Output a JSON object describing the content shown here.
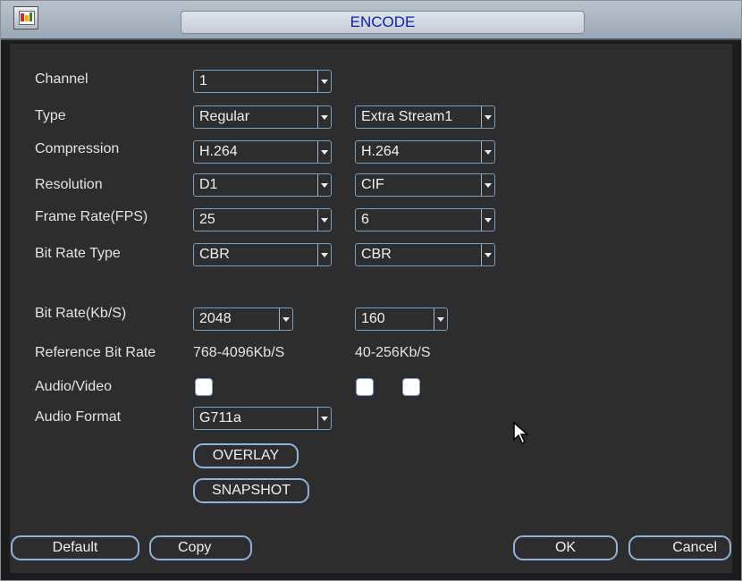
{
  "window": {
    "title": "ENCODE"
  },
  "labels": {
    "channel": "Channel",
    "type": "Type",
    "compression": "Compression",
    "resolution": "Resolution",
    "frame_rate": "Frame Rate(FPS)",
    "bit_rate_type": "Bit Rate Type",
    "bit_rate": "Bit Rate(Kb/S)",
    "reference_bit_rate": "Reference Bit Rate",
    "audio_video": "Audio/Video",
    "audio_format": "Audio Format"
  },
  "main_stream": {
    "channel": "1",
    "type": "Regular",
    "compression": "H.264",
    "resolution": "D1",
    "frame_rate": "25",
    "bit_rate_type": "CBR",
    "bit_rate": "2048",
    "reference_bit_rate": "768-4096Kb/S",
    "audio_format": "G711a"
  },
  "extra_stream": {
    "type": "Extra Stream1",
    "compression": "H.264",
    "resolution": "CIF",
    "frame_rate": "6",
    "bit_rate_type": "CBR",
    "bit_rate": "160",
    "reference_bit_rate": "40-256Kb/S"
  },
  "buttons": {
    "overlay": "OVERLAY",
    "snapshot": "SNAPSHOT",
    "default": "Default",
    "copy": "Copy",
    "ok": "OK",
    "cancel": "Cancel"
  },
  "colors": {
    "title_text": "#0f1fb0",
    "panel_bg": "#2d2d2d",
    "control_border": "#7a9bc2"
  }
}
